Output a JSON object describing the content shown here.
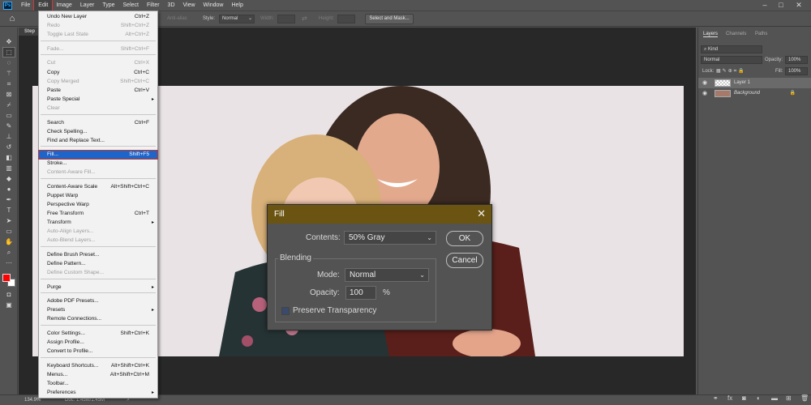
{
  "menubar": {
    "logo": "Ps",
    "items": [
      "File",
      "Edit",
      "Image",
      "Layer",
      "Type",
      "Select",
      "Filter",
      "3D",
      "View",
      "Window",
      "Help"
    ],
    "window_controls": [
      "–",
      "□",
      "✕"
    ]
  },
  "options_bar": {
    "anti_alias_label": "Anti-alias",
    "style_label": "Style:",
    "style_value": "Normal",
    "width_label": "Width:",
    "height_label": "Height:",
    "swap_icon": "⇄",
    "select_mask_label": "Select and Mask..."
  },
  "document": {
    "tab_label": "Step",
    "image_description_icon": "photo-of-woman-and-child"
  },
  "status_bar": {
    "zoom": "134.9%",
    "doc_info": "Doc: 1.45M/1.45M",
    "arrow": ">"
  },
  "edit_menu": {
    "items": [
      {
        "label": "Undo New Layer",
        "shortcut": "Ctrl+Z",
        "disabled": false
      },
      {
        "label": "Redo",
        "shortcut": "Shift+Ctrl+Z",
        "disabled": true
      },
      {
        "label": "Toggle Last State",
        "shortcut": "Alt+Ctrl+Z",
        "disabled": true
      },
      {
        "label": "Fade...",
        "shortcut": "Shift+Ctrl+F",
        "disabled": true
      },
      {
        "label": "Cut",
        "shortcut": "Ctrl+X",
        "disabled": true
      },
      {
        "label": "Copy",
        "shortcut": "Ctrl+C",
        "disabled": false
      },
      {
        "label": "Copy Merged",
        "shortcut": "Shift+Ctrl+C",
        "disabled": true
      },
      {
        "label": "Paste",
        "shortcut": "Ctrl+V",
        "disabled": false
      },
      {
        "label": "Paste Special",
        "shortcut": "",
        "disabled": false,
        "submenu": true
      },
      {
        "label": "Clear",
        "shortcut": "",
        "disabled": true
      },
      {
        "label": "Search",
        "shortcut": "Ctrl+F",
        "disabled": false
      },
      {
        "label": "Check Spelling...",
        "shortcut": "",
        "disabled": false
      },
      {
        "label": "Find and Replace Text...",
        "shortcut": "",
        "disabled": false
      },
      {
        "label": "Fill...",
        "shortcut": "Shift+F5",
        "disabled": false,
        "highlighted": true
      },
      {
        "label": "Stroke...",
        "shortcut": "",
        "disabled": false
      },
      {
        "label": "Content-Aware Fill...",
        "shortcut": "",
        "disabled": true
      },
      {
        "label": "Content-Aware Scale",
        "shortcut": "Alt+Shift+Ctrl+C",
        "disabled": false
      },
      {
        "label": "Puppet Warp",
        "shortcut": "",
        "disabled": false
      },
      {
        "label": "Perspective Warp",
        "shortcut": "",
        "disabled": false
      },
      {
        "label": "Free Transform",
        "shortcut": "Ctrl+T",
        "disabled": false
      },
      {
        "label": "Transform",
        "shortcut": "",
        "disabled": false,
        "submenu": true
      },
      {
        "label": "Auto-Align Layers...",
        "shortcut": "",
        "disabled": true
      },
      {
        "label": "Auto-Blend Layers...",
        "shortcut": "",
        "disabled": true
      },
      {
        "label": "Define Brush Preset...",
        "shortcut": "",
        "disabled": false
      },
      {
        "label": "Define Pattern...",
        "shortcut": "",
        "disabled": false
      },
      {
        "label": "Define Custom Shape...",
        "shortcut": "",
        "disabled": true
      },
      {
        "label": "Purge",
        "shortcut": "",
        "disabled": false,
        "submenu": true
      },
      {
        "label": "Adobe PDF Presets...",
        "shortcut": "",
        "disabled": false
      },
      {
        "label": "Presets",
        "shortcut": "",
        "disabled": false,
        "submenu": true
      },
      {
        "label": "Remote Connections...",
        "shortcut": "",
        "disabled": false
      },
      {
        "label": "Color Settings...",
        "shortcut": "Shift+Ctrl+K",
        "disabled": false
      },
      {
        "label": "Assign Profile...",
        "shortcut": "",
        "disabled": false
      },
      {
        "label": "Convert to Profile...",
        "shortcut": "",
        "disabled": false
      },
      {
        "label": "Keyboard Shortcuts...",
        "shortcut": "Alt+Shift+Ctrl+K",
        "disabled": false
      },
      {
        "label": "Menus...",
        "shortcut": "Alt+Shift+Ctrl+M",
        "disabled": false
      },
      {
        "label": "Toolbar...",
        "shortcut": "",
        "disabled": false
      },
      {
        "label": "Preferences",
        "shortcut": "",
        "disabled": false,
        "submenu": true
      }
    ]
  },
  "fill_dialog": {
    "title": "Fill",
    "close": "✕",
    "contents_label": "Contents:",
    "contents_value": "50% Gray",
    "ok_label": "OK",
    "cancel_label": "Cancel",
    "blending_label": "Blending",
    "mode_label": "Mode:",
    "mode_value": "Normal",
    "opacity_label": "Opacity:",
    "opacity_value": "100",
    "opacity_unit": "%",
    "preserve_label": "Preserve Transparency",
    "title_bar_color": "#6b5412"
  },
  "layers_panel": {
    "tabs": [
      "Layers",
      "Channels",
      "Paths"
    ],
    "kind_label": "Kind",
    "blend_mode": "Normal",
    "opacity_label": "Opacity:",
    "opacity_value": "100%",
    "lock_label": "Lock:",
    "fill_label": "Fill:",
    "fill_value": "100%",
    "layers": [
      {
        "name": "Layer 1",
        "selected": true
      },
      {
        "name": "Background",
        "selected": false,
        "locked": true
      }
    ]
  }
}
